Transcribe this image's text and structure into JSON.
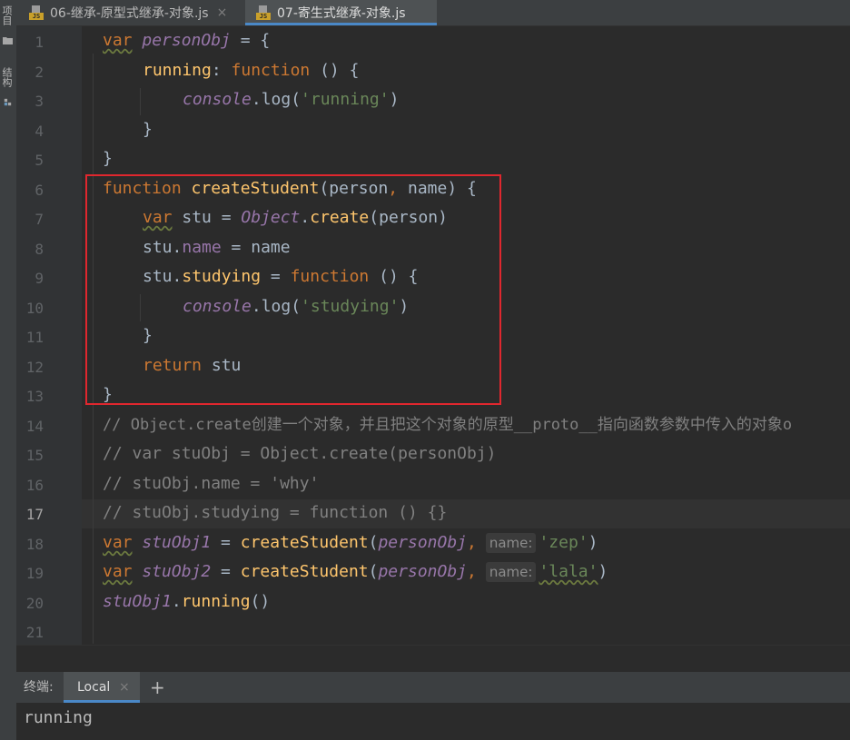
{
  "tool_window": {
    "project_label": "项目",
    "structure_label": "结构"
  },
  "tabs": [
    {
      "label": "06-继承-原型式继承-对象.js",
      "icon": "js-file-icon",
      "active": false
    },
    {
      "label": "07-寄生式继承-对象.js",
      "icon": "js-file-icon",
      "active": true
    }
  ],
  "editor": {
    "current_line": 17,
    "line_numbers": [
      "1",
      "2",
      "3",
      "4",
      "5",
      "6",
      "7",
      "8",
      "9",
      "10",
      "11",
      "12",
      "13",
      "14",
      "15",
      "16",
      "17",
      "18",
      "19",
      "20",
      "21"
    ],
    "code": {
      "l1": [
        "var",
        " ",
        "personObj",
        " = {"
      ],
      "l2": [
        "running",
        ": ",
        "function",
        " () {"
      ],
      "l3": [
        "console",
        ".log(",
        "'running'",
        ")"
      ],
      "l4": [
        "}"
      ],
      "l5": [
        "}"
      ],
      "l6": [
        "function",
        " ",
        "createStudent",
        "(person",
        ",",
        " name) {"
      ],
      "l7": [
        "var",
        " stu = ",
        "Object",
        ".",
        "create",
        "(person)"
      ],
      "l8": [
        "stu.",
        "name",
        " = name"
      ],
      "l9": [
        "stu.",
        "studying",
        " = ",
        "function",
        " () {"
      ],
      "l10": [
        "console",
        ".log(",
        "'studying'",
        ")"
      ],
      "l11": [
        "}"
      ],
      "l12": [
        "return",
        " stu"
      ],
      "l13": [
        "}"
      ],
      "l14": "// Object.create创建一个对象，并且把这个对象的原型__proto__指向函数参数中传入的对象o",
      "l15": "// var stuObj = Object.create(personObj)",
      "l16": "// stuObj.name = 'why'",
      "l17": "// stuObj.studying = function () {}",
      "l18": [
        "var",
        " ",
        "stuObj1",
        " = ",
        "createStudent",
        "(",
        "personObj",
        ",",
        "name:",
        "'zep'",
        ")"
      ],
      "l19": [
        "var",
        " ",
        "stuObj2",
        " = ",
        "createStudent",
        "(",
        "personObj",
        ",",
        "name:",
        "'lala'",
        ")"
      ],
      "l20": [
        "stuObj1",
        ".",
        "running",
        "()"
      ],
      "l21": [
        ""
      ]
    }
  },
  "terminal": {
    "label": "终端:",
    "tab_label": "Local",
    "add_symbol": "+",
    "close_symbol": "×",
    "output": "running"
  },
  "colors": {
    "background": "#2b2b2b",
    "keyword": "#cc7832",
    "function": "#ffc66d",
    "string": "#6a8759",
    "comment": "#808080",
    "variable": "#9876aa",
    "highlight_box": "#e0272e",
    "tab_accent": "#4a88c7"
  }
}
